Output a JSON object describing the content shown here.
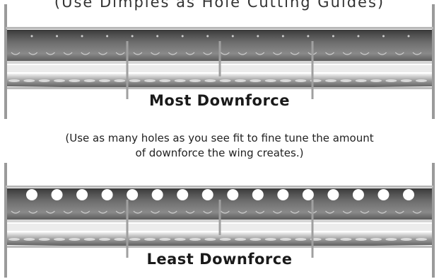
{
  "top_caption": "(Use Dimples as Hole Cutting Guides)",
  "most_label": "Most Downforce",
  "note_line1": "(Use as many holes as you see fit to fine tune the amount",
  "note_line2": "of downforce the wing creates.)",
  "least_label": "Least Downforce",
  "colors": {
    "wing_dark": "#3a3a3a",
    "wing_mid": "#8a8a8a",
    "wing_light": "#d6d6d6",
    "hole": "#ffffff"
  },
  "most_holes_cut": 0,
  "least_holes_cut": 16
}
